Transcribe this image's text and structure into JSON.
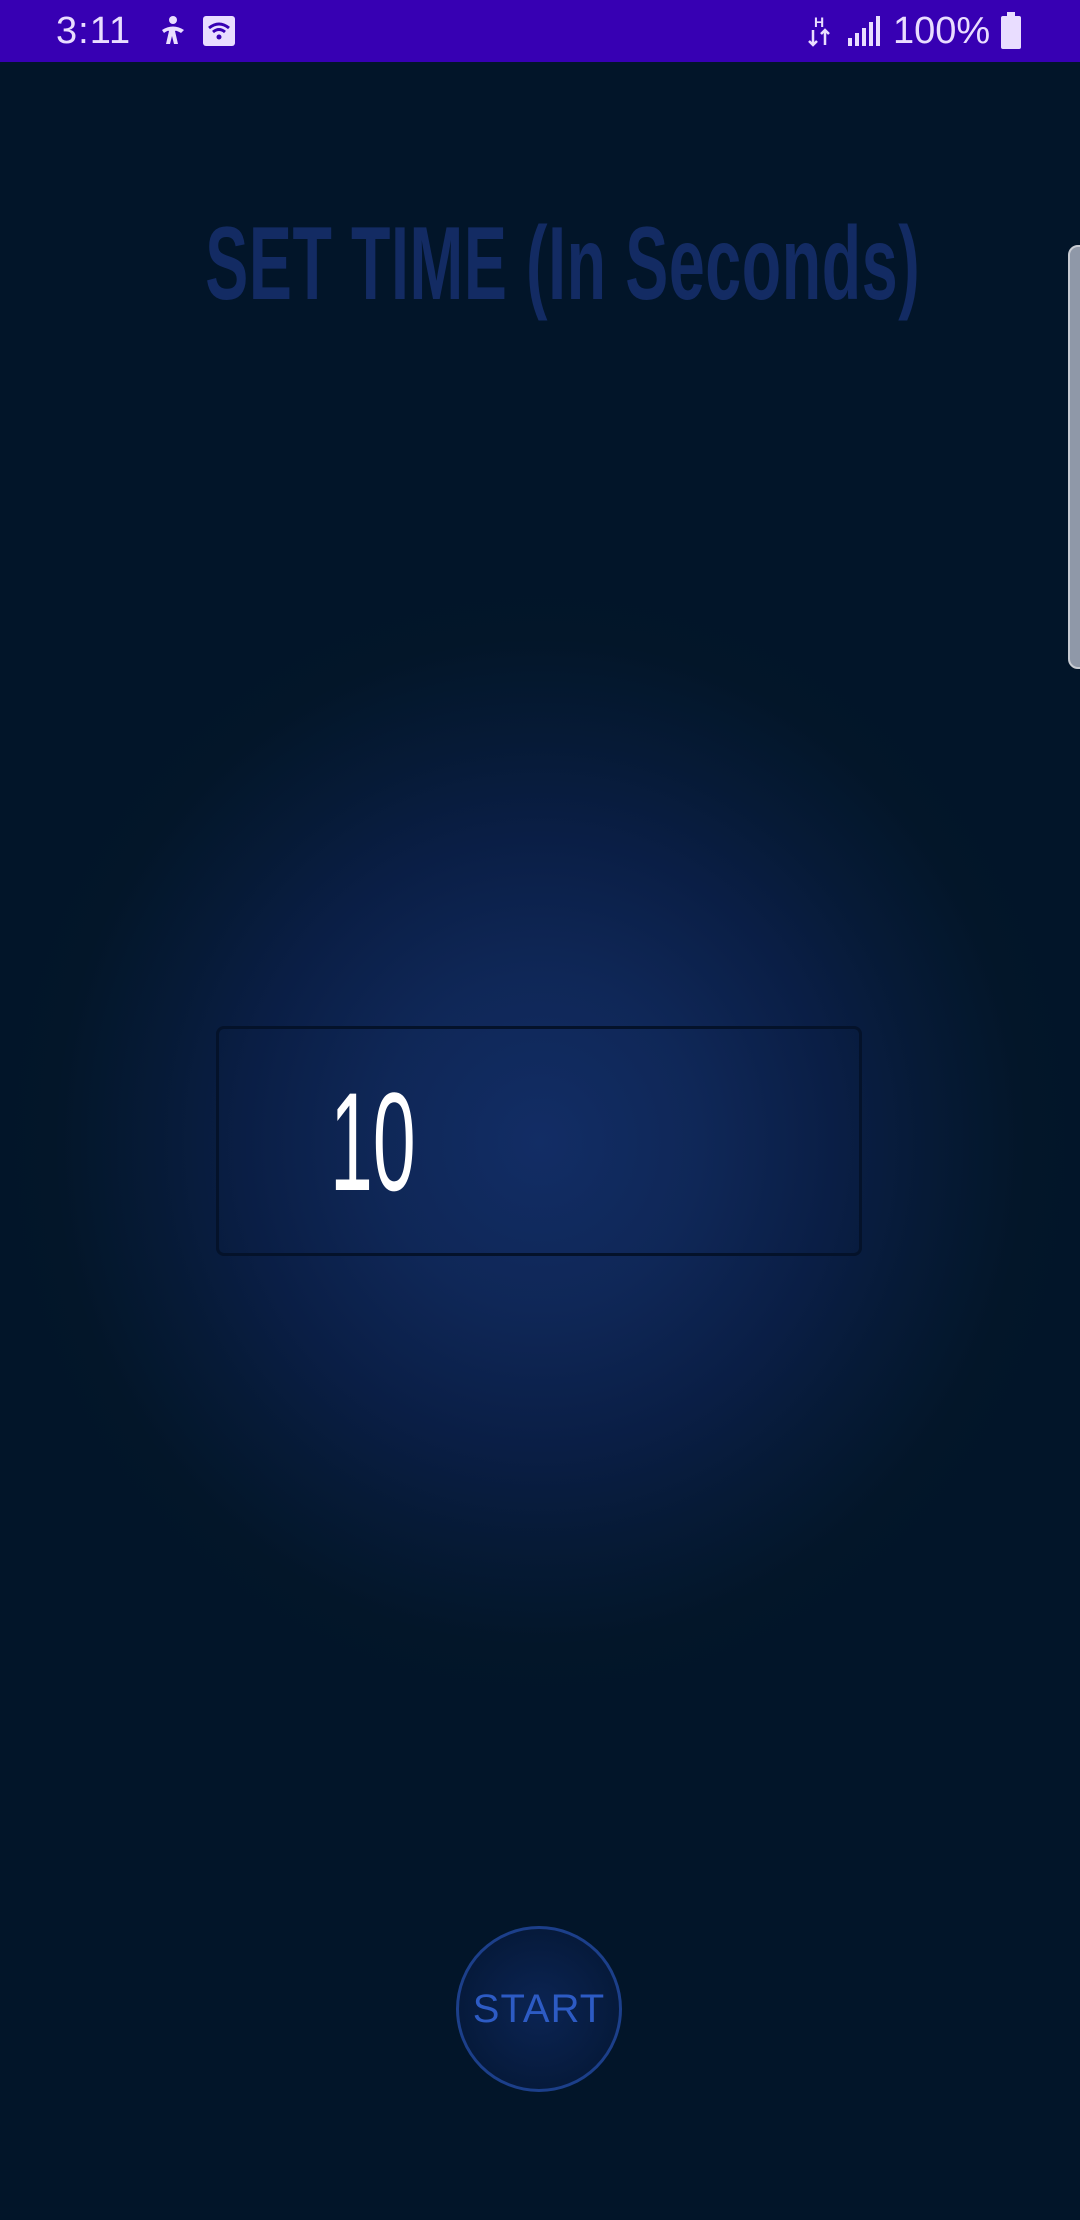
{
  "status_bar": {
    "time": "3:11",
    "icons": [
      "accessibility-icon",
      "wifi-icon",
      "data-transfer-icon",
      "signal-icon",
      "battery-icon"
    ],
    "network_type": "H",
    "battery_text": "100%"
  },
  "screen": {
    "title": "SET TIME (In Seconds)",
    "time_value": "10",
    "start_label": "START"
  },
  "colors": {
    "status_bar_bg": "#3700b3",
    "background": "#021529",
    "glow": "#122d65",
    "title": "#132b63",
    "value_text": "#ffffff",
    "start_text": "#2d5bc4"
  }
}
